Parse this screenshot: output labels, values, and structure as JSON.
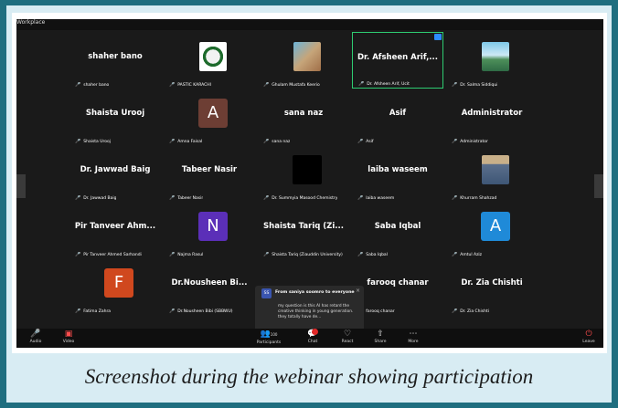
{
  "window": {
    "title": "Workplace"
  },
  "participants": [
    {
      "name": "shaher bano",
      "label": "shaher bano",
      "kind": "name"
    },
    {
      "name": "",
      "label": "PASTIC KARACHI",
      "kind": "photo",
      "icon": "logo-emblem"
    },
    {
      "name": "",
      "label": "Ghulam Mustafa Keerio",
      "kind": "photo",
      "icon": "profile-photo"
    },
    {
      "name": "Dr. Afsheen Arif,...",
      "label": "Dr. Afsheen Arif, Ucit",
      "kind": "name",
      "active": true
    },
    {
      "name": "",
      "label": "Dr. Salma Siddiqui",
      "kind": "photo",
      "icon": "landscape-photo"
    },
    {
      "name": "Shaista Urooj",
      "label": "Shaista Urooj",
      "kind": "name"
    },
    {
      "name": "A",
      "label": "Amna Faisal",
      "kind": "avatar",
      "color": "#6d3e34"
    },
    {
      "name": "sana naz",
      "label": "sana naz",
      "kind": "name"
    },
    {
      "name": "Asif",
      "label": "Asif",
      "kind": "name"
    },
    {
      "name": "Administrator",
      "label": "Administrator",
      "kind": "name"
    },
    {
      "name": "Dr. Jawwad Baig",
      "label": "Dr. Jawwad Baig",
      "kind": "name"
    },
    {
      "name": "Tabeer Nasir",
      "label": "Tabeer Nasir",
      "kind": "name"
    },
    {
      "name": "",
      "label": "Dr. Summyia Masood Chemistry",
      "kind": "blank"
    },
    {
      "name": "laiba waseem",
      "label": "laiba waseem",
      "kind": "name"
    },
    {
      "name": "",
      "label": "Khurram Shahzad",
      "kind": "photo",
      "icon": "person-photo"
    },
    {
      "name": "Pir Tanveer Ahm...",
      "label": "Pir Tanveer Ahmed Sarhandi",
      "kind": "name"
    },
    {
      "name": "N",
      "label": "Najma Rasul",
      "kind": "avatar",
      "color": "#5b2fb8"
    },
    {
      "name": "Shaista Tariq (Zi...",
      "label": "Shaista Tariq (Ziauddin University)",
      "kind": "name"
    },
    {
      "name": "Saba Iqbal",
      "label": "Saba Iqbal",
      "kind": "name"
    },
    {
      "name": "A",
      "label": "Amtul Aziz",
      "kind": "avatar",
      "color": "#1f8ad8"
    },
    {
      "name": "F",
      "label": "Fatima Zahra",
      "kind": "avatar",
      "color": "#d0481e"
    },
    {
      "name": "Dr.Nousheen Bi...",
      "label": "Dr.Nousheen Bibi (SBBWU)",
      "kind": "name"
    },
    {
      "name": "",
      "label": "",
      "kind": "hidden"
    },
    {
      "name": "farooq chanar",
      "label": "farooq chanar",
      "kind": "name"
    },
    {
      "name": "Dr. Zia Chishti",
      "label": "Dr. Zia Chishti",
      "kind": "name"
    }
  ],
  "chat_popup": {
    "initials": "SS",
    "from": "From saniya soomro to everyone",
    "message": "my question is this AI has retard the creative thinking in young generation. they totally have de..."
  },
  "toolbar": {
    "audio": "Audio",
    "video": "Video",
    "participants": "Participants",
    "participants_count": "100",
    "chat": "Chat",
    "react": "React",
    "share": "Share",
    "more": "More",
    "leave": "Leave"
  },
  "caption": "Screenshot during the webinar showing participation"
}
